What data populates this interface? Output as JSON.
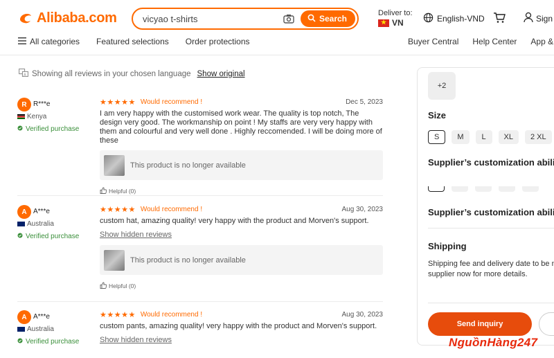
{
  "header": {
    "logo_text": "Alibaba.com",
    "search_value": "vicyao t-shirts",
    "search_button": "Search",
    "deliver_label": "Deliver to:",
    "deliver_country": "VN",
    "language": "English-VND",
    "sign_in": "Sign"
  },
  "nav": {
    "all_categories": "All categories",
    "featured": "Featured selections",
    "order_protections": "Order protections",
    "buyer_central": "Buyer Central",
    "help_center": "Help Center",
    "app": "App & ext"
  },
  "reviews_header": {
    "note": "Showing all reviews in your chosen language",
    "show_original": "Show original"
  },
  "reviews": [
    {
      "initial": "R",
      "name": "R***e",
      "country": "Kenya",
      "verified": "Verified purchase",
      "stars": "★★★★★",
      "recommend": "Would recommend !",
      "date": "Dec 5, 2023",
      "text": "I am very happy with the customised work wear. The quality is top notch, The design very good. The workmanship on point ! My staffs are very very happy with them and colourful and very well done . Highly reccomended. I will be doing more of these",
      "product": "This product is no longer available",
      "helpful": "Helpful (0)"
    },
    {
      "initial": "A",
      "name": "A***e",
      "country": "Australia",
      "verified": "Verified purchase",
      "stars": "★★★★★",
      "recommend": "Would recommend !",
      "date": "Aug 30, 2023",
      "text": "custom hat, amazing quality! very happy with the product and Morven's support.",
      "hidden": "Show hidden reviews",
      "product": "This product is no longer available",
      "helpful": "Helpful (0)"
    },
    {
      "initial": "A",
      "name": "A***e",
      "country": "Australia",
      "verified": "Verified purchase",
      "stars": "★★★★★",
      "recommend": "Would recommend !",
      "date": "Aug 30, 2023",
      "text": "custom pants, amazing quality! very happy with the product and Morven's support.",
      "hidden": "Show hidden reviews"
    }
  ],
  "panel": {
    "more": "+2",
    "size_title": "Size",
    "sizes": [
      "S",
      "M",
      "L",
      "XL",
      "2 XL"
    ],
    "customization_title_1": "Supplier’s customization abili",
    "customization_title_2": "Supplier’s customization abili",
    "shipping_title": "Shipping",
    "shipping_line_1": "Shipping fee and delivery date to be n",
    "shipping_line_2": "supplier now for more details.",
    "send_inquiry": "Send inquiry"
  },
  "watermark": "NguồnHàng247"
}
